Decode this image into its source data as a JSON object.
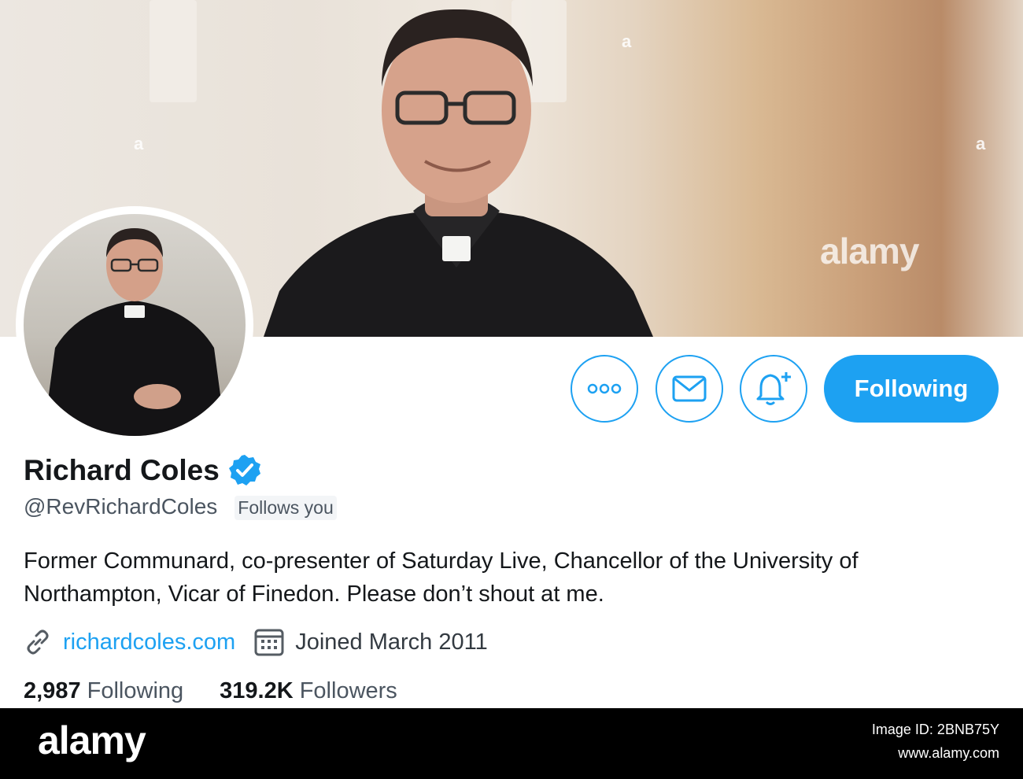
{
  "header": {
    "watermark_banner": "alamy"
  },
  "profile": {
    "display_name": "Richard Coles",
    "verified_icon": "verified-badge-icon",
    "handle": "@RevRichardColes",
    "follows_you": "Follows you",
    "bio": "Former Communard, co-presenter of Saturday Live, Chancellor of the University of Northampton, Vicar of Finedon. Please don’t shout at me.",
    "website": "richardcoles.com",
    "joined": "Joined March 2011",
    "following_count": "2,987",
    "following_label": "Following",
    "followers_count": "319.2K",
    "followers_label": "Followers"
  },
  "actions": {
    "more_icon": "more-icon",
    "message_icon": "mail-icon",
    "notify_icon": "bell-plus-icon",
    "follow_button_label": "Following"
  },
  "footer": {
    "logo": "alamy",
    "image_id": "Image ID: 2BNB75Y",
    "site": "www.alamy.com"
  },
  "colors": {
    "accent": "#1da1f2",
    "text": "#14171a",
    "secondary_text": "#4b5560"
  }
}
